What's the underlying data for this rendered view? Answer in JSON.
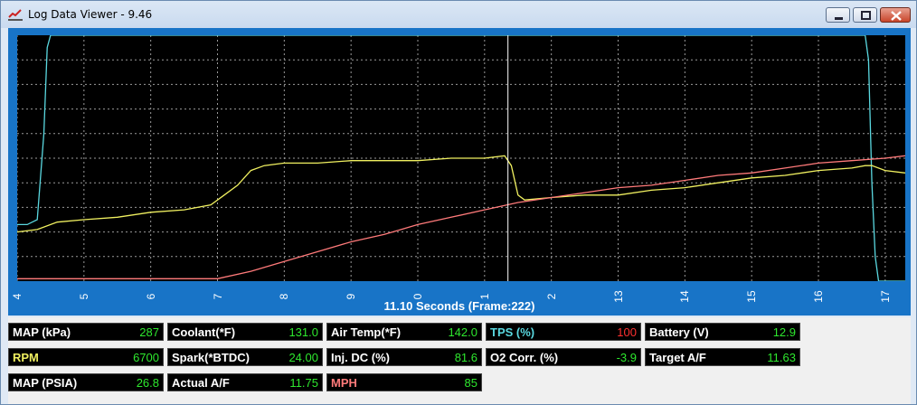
{
  "window": {
    "title": "Log Data Viewer - 9.46",
    "icons": [
      "chart-app-icon",
      "minimize-icon",
      "maximize-icon",
      "close-icon"
    ]
  },
  "chart_data": {
    "type": "line",
    "xlabel": "11.10 Seconds (Frame:222)",
    "x_ticks": [
      "4",
      "5",
      "6",
      "7",
      "8",
      "9",
      "0",
      "1",
      "2",
      "13",
      "14",
      "15",
      "16",
      "17"
    ],
    "cursor_x": 11.35,
    "xlim": [
      4,
      17.3
    ],
    "ylim": [
      0,
      100
    ],
    "grid": true,
    "background": "#000000",
    "series": [
      {
        "color": "#5ad8e0",
        "x": [
          4,
          4.15,
          4.3,
          4.4,
          4.45,
          4.5,
          4.55,
          16.7,
          16.75,
          16.8,
          16.85,
          16.9,
          16.95,
          17.3
        ],
        "y": [
          23,
          23,
          25,
          60,
          95,
          100,
          100,
          100,
          90,
          40,
          10,
          0,
          0,
          0
        ]
      },
      {
        "color": "#f0f060",
        "x": [
          4,
          4.3,
          4.6,
          5,
          5.5,
          6,
          6.5,
          6.9,
          7.1,
          7.3,
          7.5,
          7.7,
          8,
          8.5,
          9,
          9.5,
          10,
          10.5,
          11,
          11.3,
          11.4,
          11.5,
          11.6,
          12,
          12.5,
          13,
          13.5,
          14,
          14.5,
          15,
          15.5,
          16,
          16.5,
          16.7,
          16.8,
          17,
          17.3
        ],
        "y": [
          20,
          21,
          24,
          25,
          26,
          28,
          29,
          31,
          35,
          39,
          45,
          47,
          48,
          48,
          49,
          49,
          49,
          50,
          50,
          51,
          47,
          35,
          33,
          34,
          35,
          35,
          37,
          38,
          40,
          42,
          43,
          45,
          46,
          47,
          47,
          45,
          44
        ]
      },
      {
        "color": "#ff7a7a",
        "x": [
          4,
          5,
          6,
          7,
          7.5,
          8,
          8.5,
          9,
          9.5,
          10,
          10.5,
          11,
          11.5,
          12,
          12.5,
          13,
          13.5,
          14,
          14.5,
          15,
          15.5,
          16,
          16.5,
          17,
          17.3
        ],
        "y": [
          1,
          1,
          1,
          1,
          4,
          8,
          12,
          16,
          19,
          23,
          26,
          29,
          32,
          34,
          36,
          38,
          39,
          41,
          43,
          44,
          46,
          48,
          49,
          50,
          51
        ]
      }
    ]
  },
  "readouts": [
    {
      "label": "MAP (kPa)",
      "value": "287",
      "label_color": "#ffffff",
      "value_color": "#2ee82e"
    },
    {
      "label": "Coolant(*F)",
      "value": "131.0",
      "label_color": "#ffffff",
      "value_color": "#2ee82e"
    },
    {
      "label": "Air Temp(*F)",
      "value": "142.0",
      "label_color": "#ffffff",
      "value_color": "#2ee82e"
    },
    {
      "label": "TPS (%)",
      "value": "100",
      "label_color": "#5ad8e0",
      "value_color": "#ff3030"
    },
    {
      "label": "Battery (V)",
      "value": "12.9",
      "label_color": "#ffffff",
      "value_color": "#2ee82e"
    },
    {
      "label": "RPM",
      "value": "6700",
      "label_color": "#f0f060",
      "value_color": "#2ee82e"
    },
    {
      "label": "Spark(*BTDC)",
      "value": "24.00",
      "label_color": "#ffffff",
      "value_color": "#2ee82e"
    },
    {
      "label": "Inj. DC (%)",
      "value": "81.6",
      "label_color": "#ffffff",
      "value_color": "#2ee82e"
    },
    {
      "label": "O2 Corr. (%)",
      "value": "-3.9",
      "label_color": "#ffffff",
      "value_color": "#2ee82e"
    },
    {
      "label": "Target A/F",
      "value": "11.63",
      "label_color": "#ffffff",
      "value_color": "#2ee82e"
    },
    {
      "label": "MAP (PSIA)",
      "value": "26.8",
      "label_color": "#ffffff",
      "value_color": "#2ee82e"
    },
    {
      "label": "Actual A/F",
      "value": "11.75",
      "label_color": "#ffffff",
      "value_color": "#2ee82e"
    },
    {
      "label": "MPH",
      "value": "85",
      "label_color": "#ff7a7a",
      "value_color": "#2ee82e"
    }
  ]
}
